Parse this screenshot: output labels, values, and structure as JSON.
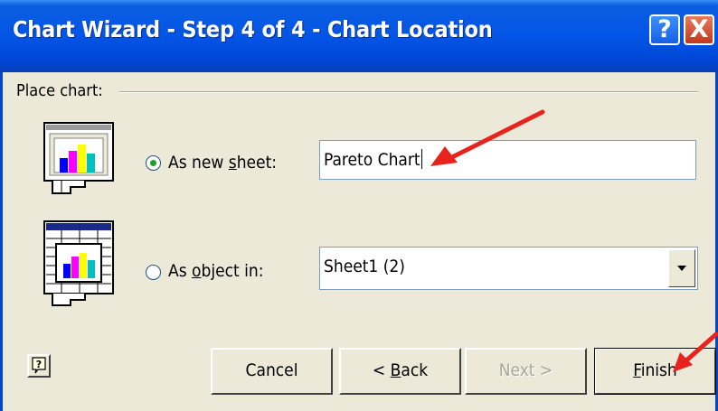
{
  "window": {
    "title": "Chart Wizard - Step 4 of 4 - Chart Location",
    "help_glyph": "?",
    "close_glyph": "X"
  },
  "group": {
    "label": "Place chart:"
  },
  "option_new_sheet": {
    "label_pre": "As new ",
    "label_key": "s",
    "label_post": "heet:",
    "selected": true,
    "value": "Pareto Chart",
    "icon": "chart-sheet-icon"
  },
  "option_object": {
    "label_pre": "As ",
    "label_key": "o",
    "label_post": "bject in:",
    "selected": false,
    "value": "Sheet1 (2)",
    "icon": "embedded-chart-icon"
  },
  "buttons": {
    "cancel": "Cancel",
    "back_pre": "< ",
    "back_key": "B",
    "back_post": "ack",
    "next": "Next >",
    "finish_key": "F",
    "finish_post": "inish"
  },
  "colors": {
    "titlebar": "#0355e6",
    "dialog_bg": "#ece9d8",
    "annotation_arrow": "#e8231e",
    "radio_dot": "#21a121"
  }
}
